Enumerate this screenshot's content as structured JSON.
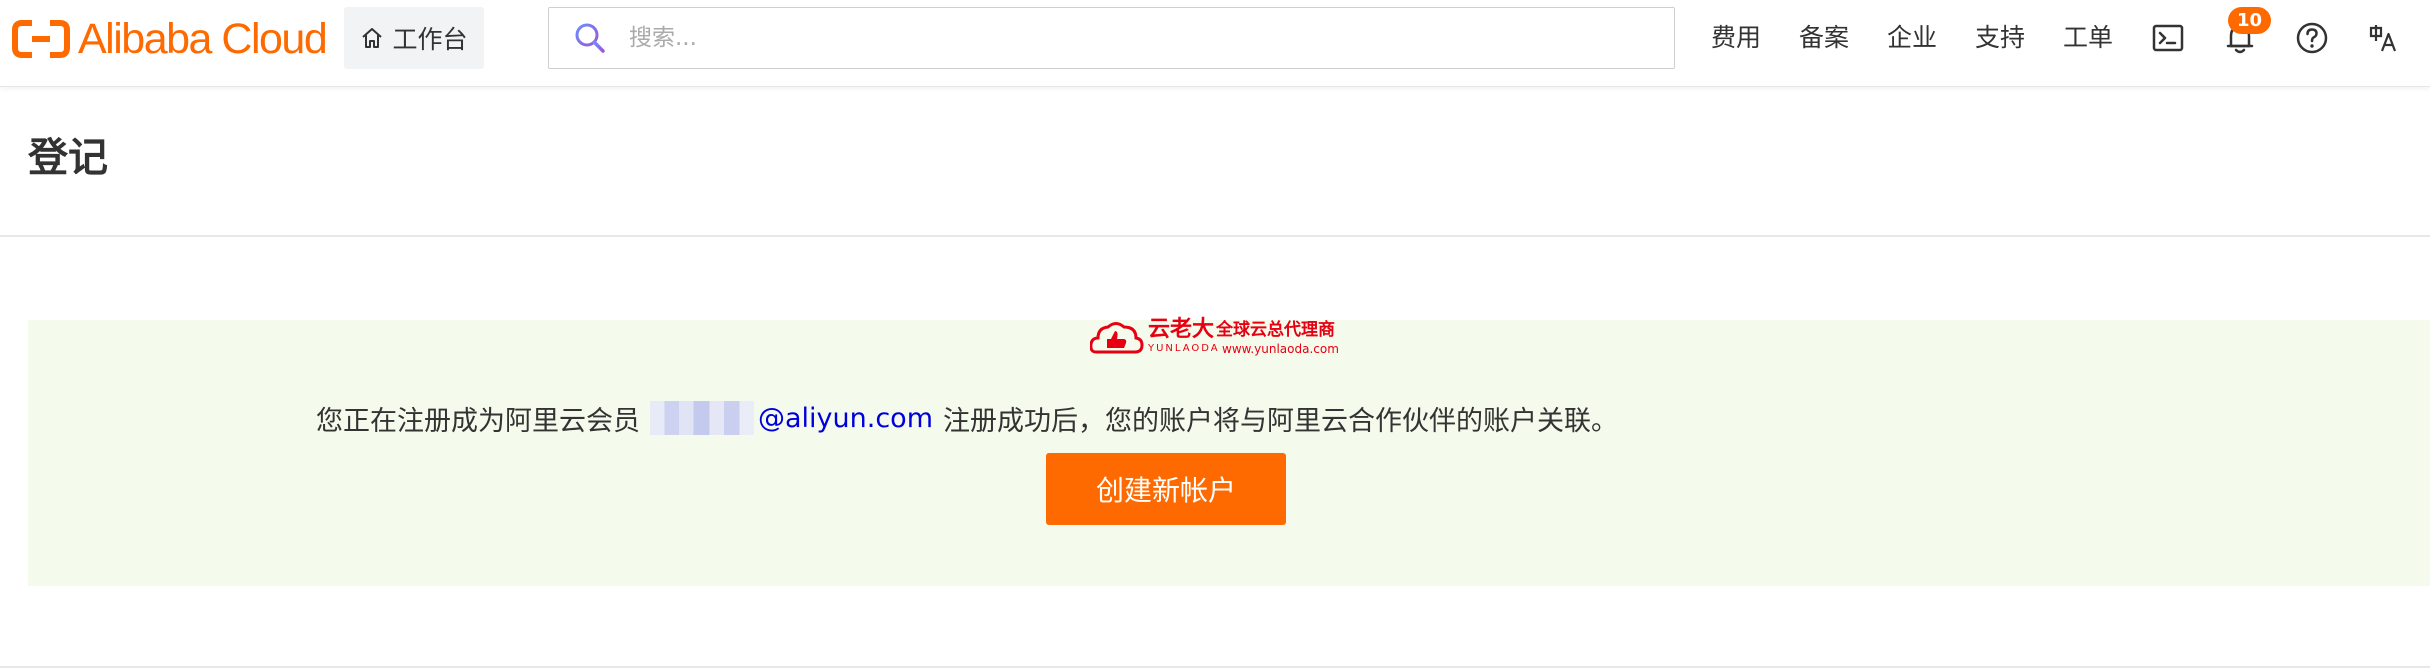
{
  "brand": {
    "name": "Alibaba Cloud",
    "color": "#ff6a00"
  },
  "header": {
    "workbench_label": "工作台",
    "search_placeholder": "搜索...",
    "nav_links": [
      "费用",
      "备案",
      "企业",
      "支持",
      "工单"
    ],
    "icons": [
      "terminal-icon",
      "bell-icon",
      "help-icon",
      "language-icon"
    ],
    "notification_count": "10"
  },
  "page": {
    "title": "登记"
  },
  "watermark": {
    "name": "云老大",
    "latin": "YUNLAODA",
    "slogan": "全球云总代理商",
    "url": "www.yunlaoda.com",
    "color": "#e60012"
  },
  "notice": {
    "prefix": "您正在注册成为阿里云会员",
    "email_domain": "@aliyun.com",
    "suffix": "注册成功后，您的账户将与阿里云合作伙伴的账户关联。",
    "button_label": "创建新帐户",
    "panel_color": "#f4fbec",
    "button_color": "#ff6a00"
  }
}
